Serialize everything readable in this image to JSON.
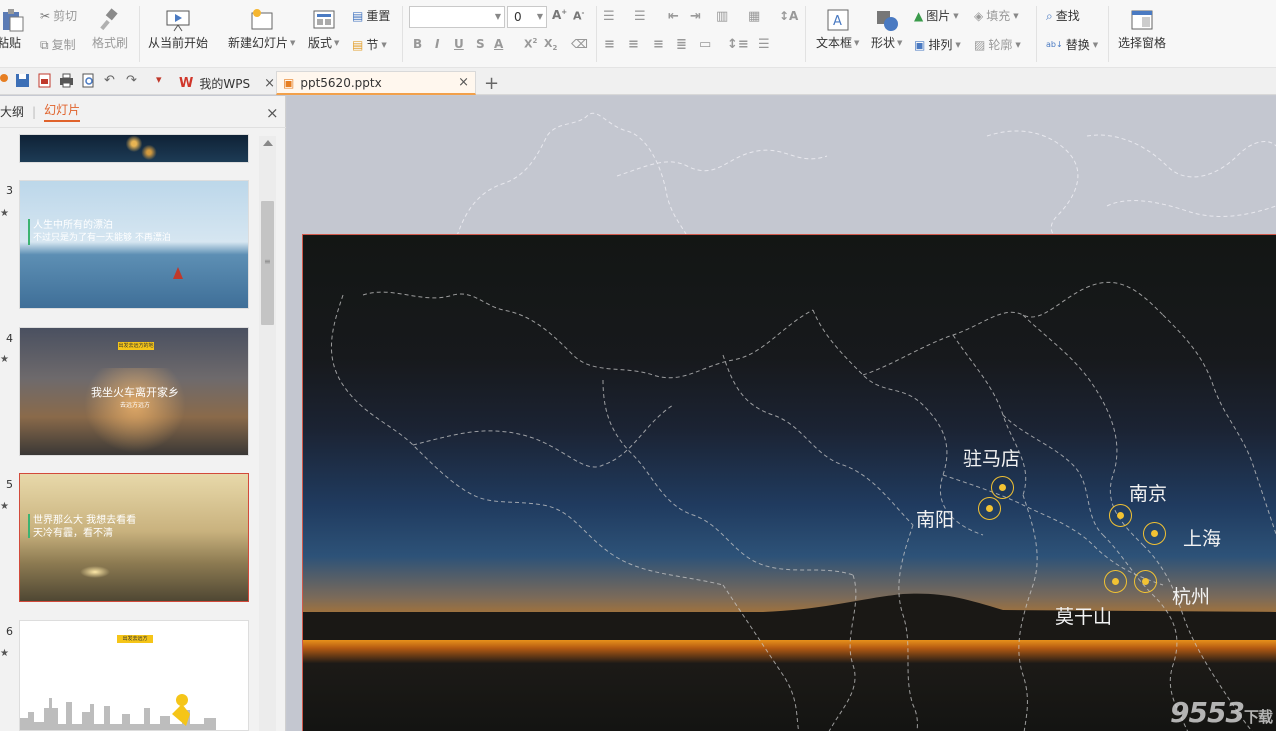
{
  "ribbon": {
    "paste": "粘贴",
    "cut": "剪切",
    "copy": "复制",
    "format_painter": "格式刷",
    "from_current": "从当前开始",
    "new_slide": "新建幻灯片",
    "layout": "版式",
    "reset": "重置",
    "section": "节",
    "font_size": "0",
    "text_box": "文本框",
    "shape": "形状",
    "picture": "图片",
    "arrange": "排列",
    "fill": "填充",
    "outline": "轮廓",
    "find": "查找",
    "replace": "替换",
    "selection_pane": "选择窗格"
  },
  "tabs": [
    {
      "label": "我的WPS"
    },
    {
      "label": "ppt5620.pptx"
    }
  ],
  "left_pane": {
    "outline_tab": "大纲",
    "slides_tab": "幻灯片",
    "slides": [
      {
        "num": "3",
        "lines": [
          "人生中所有的漂泊",
          "不过只是为了有一天能够    不再漂泊"
        ]
      },
      {
        "num": "4",
        "banner": "出发去远方的地方",
        "lines": [
          "我坐火车离开家乡",
          "去远方远方"
        ]
      },
      {
        "num": "5",
        "lines": [
          "世界那么大 我想去看看",
          "天冷有霾，看不清"
        ]
      },
      {
        "num": "6",
        "banner": "出发去远方"
      }
    ]
  },
  "slide": {
    "cities": [
      "驻马店",
      "南阳",
      "南京",
      "上海",
      "杭州",
      "莫干山"
    ]
  },
  "watermark": {
    "brand": "9553",
    "suffix": "下载"
  }
}
